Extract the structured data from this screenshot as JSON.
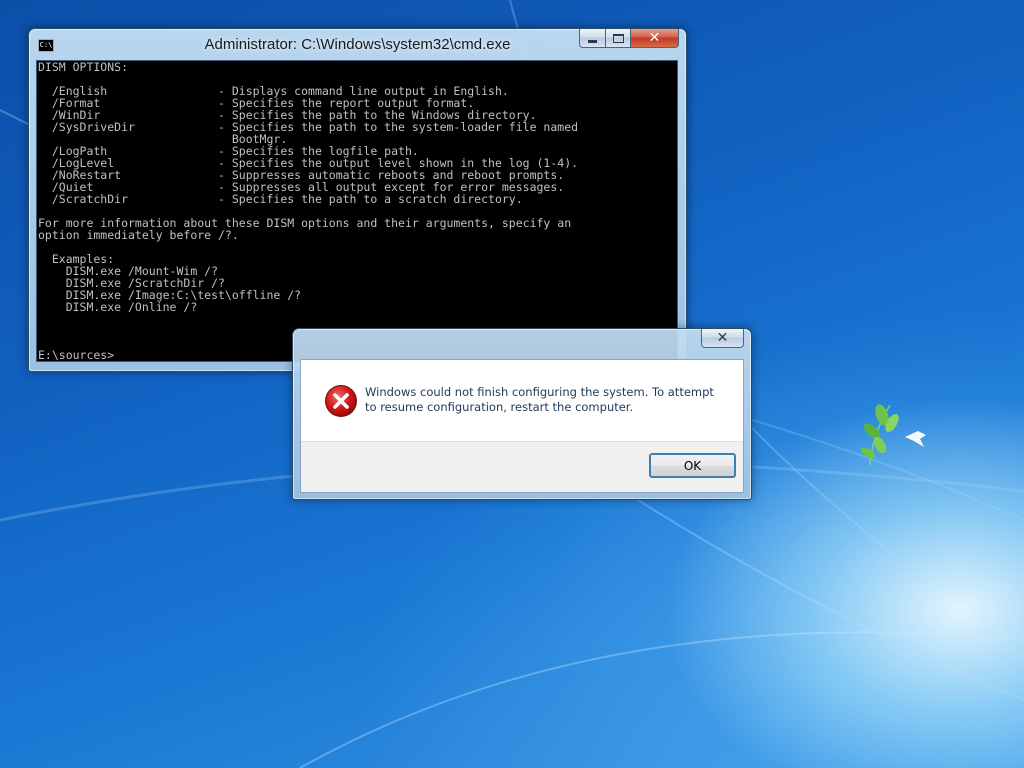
{
  "cmd": {
    "title": "Administrator: C:\\Windows\\system32\\cmd.exe",
    "icon_text": "C:\\",
    "lines": [
      "DISM OPTIONS:",
      "",
      "  /English                - Displays command line output in English.",
      "  /Format                 - Specifies the report output format.",
      "  /WinDir                 - Specifies the path to the Windows directory.",
      "  /SysDriveDir            - Specifies the path to the system-loader file named",
      "                            BootMgr.",
      "  /LogPath                - Specifies the logfile path.",
      "  /LogLevel               - Specifies the output level shown in the log (1-4).",
      "  /NoRestart              - Suppresses automatic reboots and reboot prompts.",
      "  /Quiet                  - Suppresses all output except for error messages.",
      "  /ScratchDir             - Specifies the path to a scratch directory.",
      "",
      "For more information about these DISM options and their arguments, specify an",
      "option immediately before /?.",
      "",
      "  Examples:",
      "    DISM.exe /Mount-Wim /?",
      "    DISM.exe /ScratchDir /?",
      "    DISM.exe /Image:C:\\test\\offline /?",
      "    DISM.exe /Online /?",
      "",
      "",
      "",
      "E:\\sources>"
    ]
  },
  "dialog": {
    "message": "Windows could not finish configuring the system. To attempt to resume configuration, restart the computer.",
    "ok_label": "OK",
    "icon": "error-icon"
  },
  "colors": {
    "console_bg": "#000000",
    "console_fg": "#c0c0c0",
    "desktop_blue": "#1160c0",
    "error_red": "#c8102e"
  }
}
